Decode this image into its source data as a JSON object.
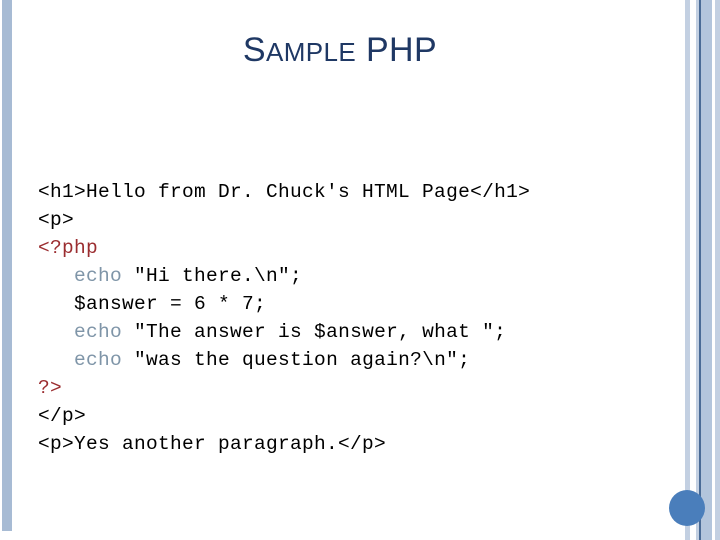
{
  "slide": {
    "title": {
      "lead_cap": "S",
      "small_caps": "AMPLE",
      "rest": " PHP",
      "full_text": "SAMPLE PHP",
      "color": "#1F3864"
    },
    "decor": {
      "left_bar_color": "#A7BBD4",
      "stripe_light_color": "#C3D0E2",
      "stripe_mid_color": "#B3C5DC",
      "stripe_dark_color": "#4A6B96",
      "circle_color": "#4A7EBB"
    },
    "code": {
      "php_tag_color": "#9B2D30",
      "echo_color": "#7F95A8",
      "plain_color": "#000000",
      "lines": [
        {
          "id": "line-1",
          "segments": [
            {
              "style": "plain",
              "text": "<h1>Hello from Dr. Chuck's HTML Page</h1>"
            }
          ]
        },
        {
          "id": "line-2",
          "segments": [
            {
              "style": "plain",
              "text": "<p>"
            }
          ]
        },
        {
          "id": "line-3",
          "segments": [
            {
              "style": "php",
              "text": "<?php"
            }
          ]
        },
        {
          "id": "line-4",
          "segments": [
            {
              "style": "plain",
              "text": "   "
            },
            {
              "style": "echo",
              "text": "echo"
            },
            {
              "style": "plain",
              "text": " \"Hi there.\\n\";"
            }
          ]
        },
        {
          "id": "line-5",
          "segments": [
            {
              "style": "plain",
              "text": "   $answer = 6 * 7;"
            }
          ]
        },
        {
          "id": "line-6",
          "segments": [
            {
              "style": "plain",
              "text": "   "
            },
            {
              "style": "echo",
              "text": "echo"
            },
            {
              "style": "plain",
              "text": " \"The answer is $answer, what \";"
            }
          ]
        },
        {
          "id": "line-7",
          "segments": [
            {
              "style": "plain",
              "text": "   "
            },
            {
              "style": "echo",
              "text": "echo"
            },
            {
              "style": "plain",
              "text": " \"was the question again?\\n\";"
            }
          ]
        },
        {
          "id": "line-8",
          "segments": [
            {
              "style": "php",
              "text": "?>"
            }
          ]
        },
        {
          "id": "line-9",
          "segments": [
            {
              "style": "plain",
              "text": "</p>"
            }
          ]
        },
        {
          "id": "line-10",
          "segments": [
            {
              "style": "plain",
              "text": "<p>Yes another paragraph.</p>"
            }
          ]
        }
      ]
    }
  }
}
